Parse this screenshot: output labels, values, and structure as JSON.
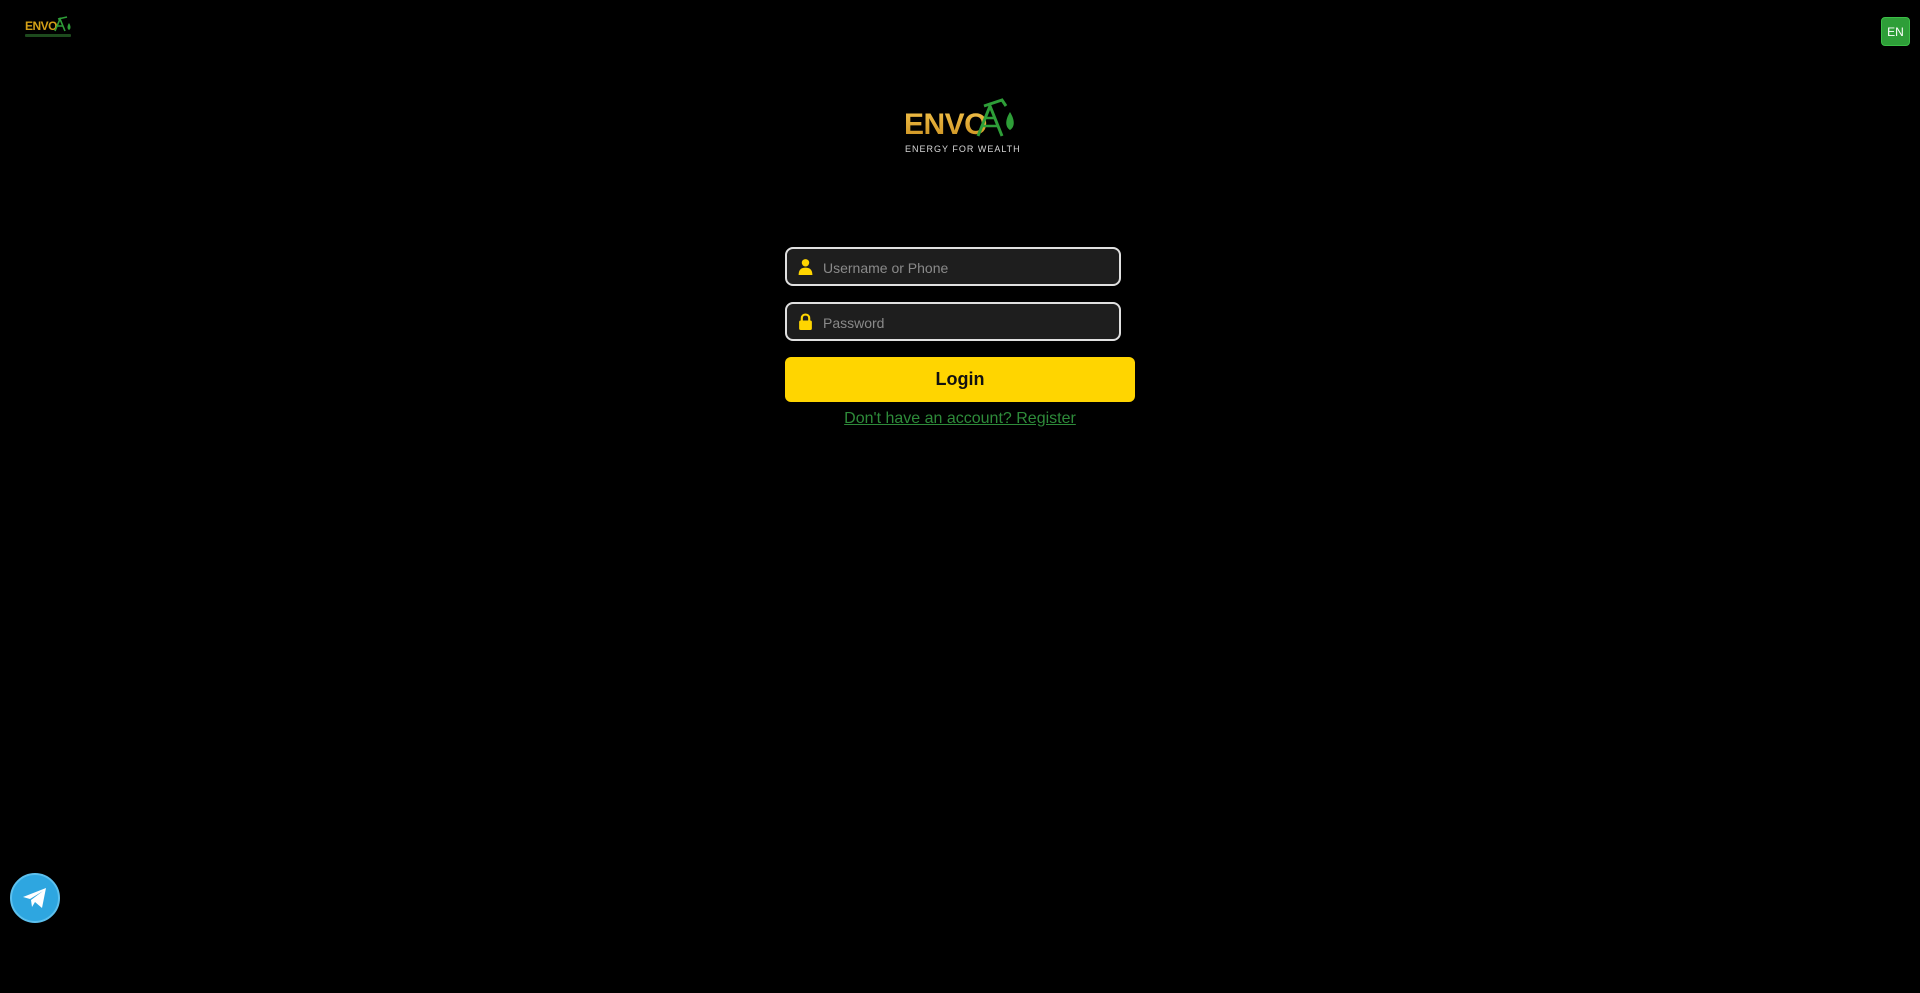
{
  "header": {
    "logo_text": "ENVO",
    "language_button": "EN"
  },
  "brand": {
    "logo_text": "ENVO",
    "slogan": "ENERGY FOR WEALTH",
    "gold": "#d4a017",
    "green": "#2e9e38"
  },
  "form": {
    "username_placeholder": "Username or Phone",
    "username_value": "",
    "password_placeholder": "Password",
    "password_value": "",
    "login_label": "Login",
    "register_link": "Don't have an account? Register",
    "accent": "#ffd500"
  },
  "icons": {
    "username": "user-icon",
    "password": "lock-icon",
    "support": "telegram-icon"
  }
}
